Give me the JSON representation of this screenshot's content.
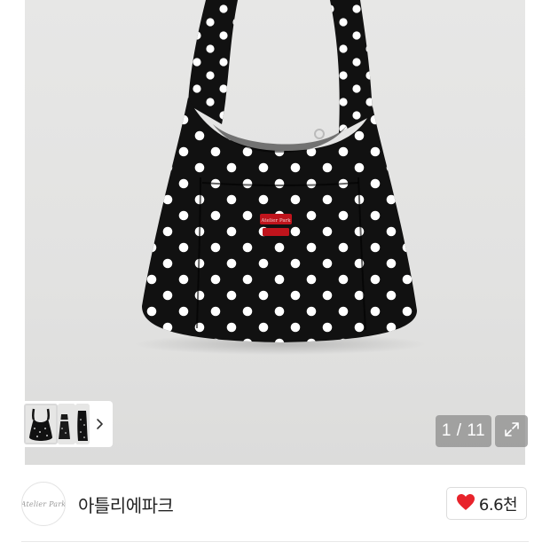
{
  "gallery": {
    "photo_alt": "polka dot hobo bag",
    "counter": "1 / 11",
    "thumbnail_count_visible": 3,
    "active_thumbnail": 1,
    "next_icon": "chevron-right-icon",
    "expand_icon": "expand-icon",
    "colors": {
      "bag": "#111111",
      "dots": "#ffffff",
      "background": "#e4e4e3",
      "patch": "#c0141c"
    }
  },
  "seller": {
    "name": "아틀리에파크",
    "avatar_logo_text": "Atelier Park"
  },
  "like": {
    "icon": "heart-icon",
    "count": "6.6천",
    "icon_color": "#e8232b"
  }
}
